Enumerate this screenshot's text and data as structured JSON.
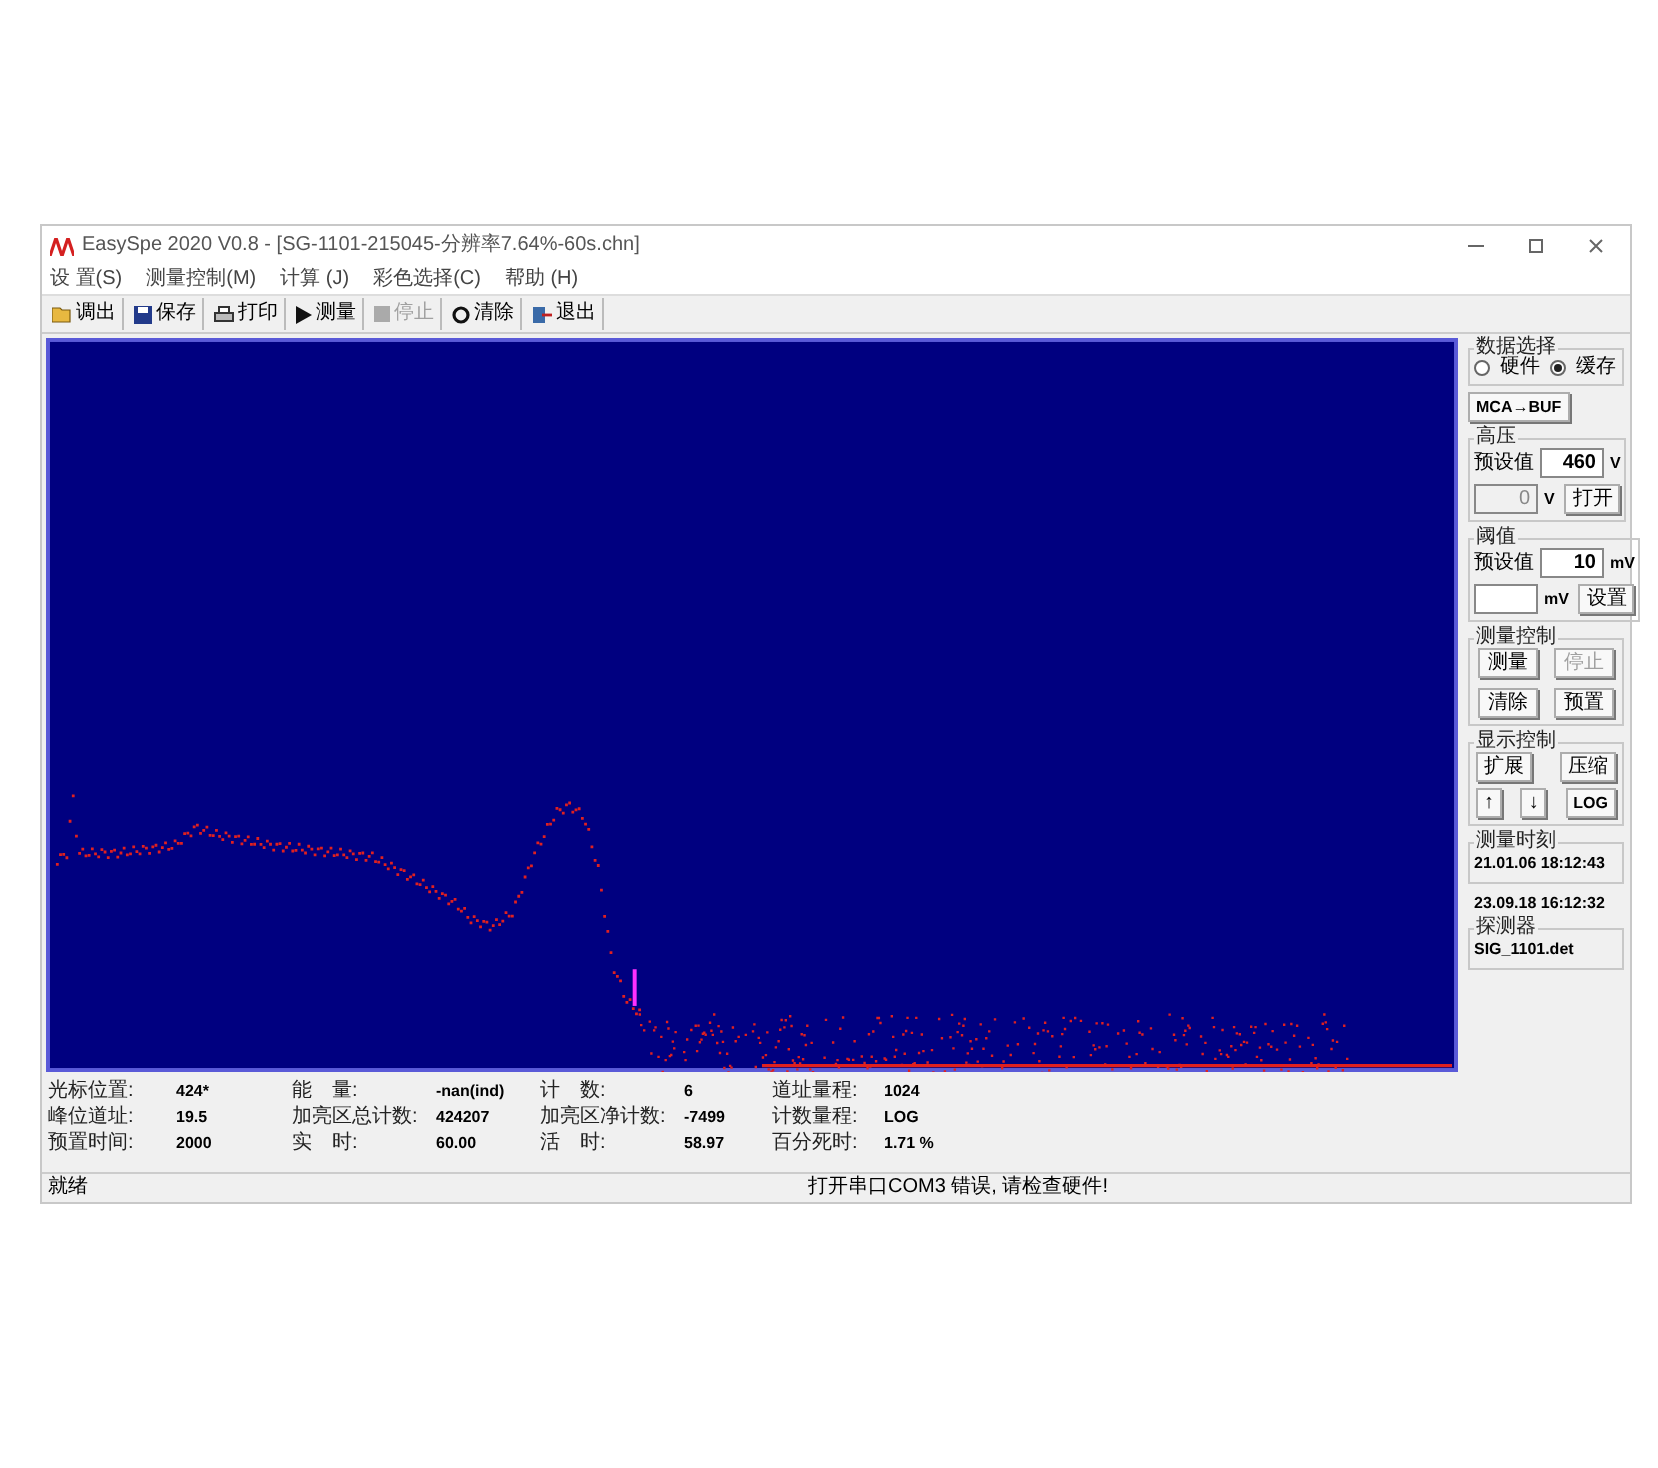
{
  "window": {
    "title": "EasySpe 2020 V0.8 - [SG-1101-215045-分辨率7.64%-60s.chn]"
  },
  "menu": [
    "设 置(S)",
    "测量控制(M)",
    "计算 (J)",
    "彩色选择(C)",
    "帮助 (H)"
  ],
  "toolbar": [
    {
      "kind": "open",
      "label": "调出",
      "disabled": false
    },
    {
      "kind": "save",
      "label": "保存",
      "disabled": false
    },
    {
      "kind": "print",
      "label": "打印",
      "disabled": false
    },
    {
      "kind": "play",
      "label": "测量",
      "disabled": false
    },
    {
      "kind": "stop",
      "label": "停止",
      "disabled": true
    },
    {
      "kind": "clear",
      "label": "清除",
      "disabled": false
    },
    {
      "kind": "exit",
      "label": "退出",
      "disabled": false
    }
  ],
  "data_source": {
    "title": "数据选择",
    "options": [
      {
        "label": "硬件",
        "selected": false
      },
      {
        "label": "缓存",
        "selected": true
      }
    ]
  },
  "mca_button": "MCA→BUF",
  "high_voltage": {
    "title": "高压",
    "preset_label": "预设值",
    "preset_value": "460",
    "preset_unit": "V",
    "actual_value": "0",
    "actual_unit": "V",
    "button": "打开"
  },
  "threshold": {
    "title": "阈值",
    "preset_label": "预设值",
    "preset_value": "10",
    "preset_unit": "mV",
    "actual_unit": "mV",
    "button": "设置"
  },
  "measure_control": {
    "title": "测量控制",
    "buttons": [
      {
        "label": "测量",
        "disabled": false
      },
      {
        "label": "停止",
        "disabled": true
      },
      {
        "label": "清除",
        "disabled": false
      },
      {
        "label": "预置",
        "disabled": false
      }
    ]
  },
  "display_control": {
    "title": "显示控制",
    "buttons": [
      {
        "label": "扩展"
      },
      {
        "label": "压缩"
      },
      {
        "label": "↑"
      },
      {
        "label": "↓"
      },
      {
        "label": "LOG"
      }
    ]
  },
  "measure_time": {
    "title": "测量时刻",
    "value": "21.01.06  18:12:43"
  },
  "detector": {
    "date": "23.09.18  16:12:32",
    "title": "探测器",
    "value": "SIG_1101.det"
  },
  "info": [
    {
      "label": "光标位置:",
      "value": "424*"
    },
    {
      "label": "能　量:",
      "value": "-nan(ind)"
    },
    {
      "label": "计　数:",
      "value": "6"
    },
    {
      "label": "道址量程:",
      "value": "1024"
    },
    {
      "label": "峰位道址:",
      "value": "19.5"
    },
    {
      "label": "加亮区总计数:",
      "value": "424207"
    },
    {
      "label": "加亮区净计数:",
      "value": "-7499"
    },
    {
      "label": "计数量程:",
      "value": "LOG"
    },
    {
      "label": "预置时间:",
      "value": "2000"
    },
    {
      "label": "实　时:",
      "value": "60.00"
    },
    {
      "label": "活　时:",
      "value": "58.97"
    },
    {
      "label": "百分死时:",
      "value": "1.71  %"
    }
  ],
  "status_bar": {
    "left": "就绪",
    "message": "打开串口COM3 错误, 请检查硬件!"
  }
}
